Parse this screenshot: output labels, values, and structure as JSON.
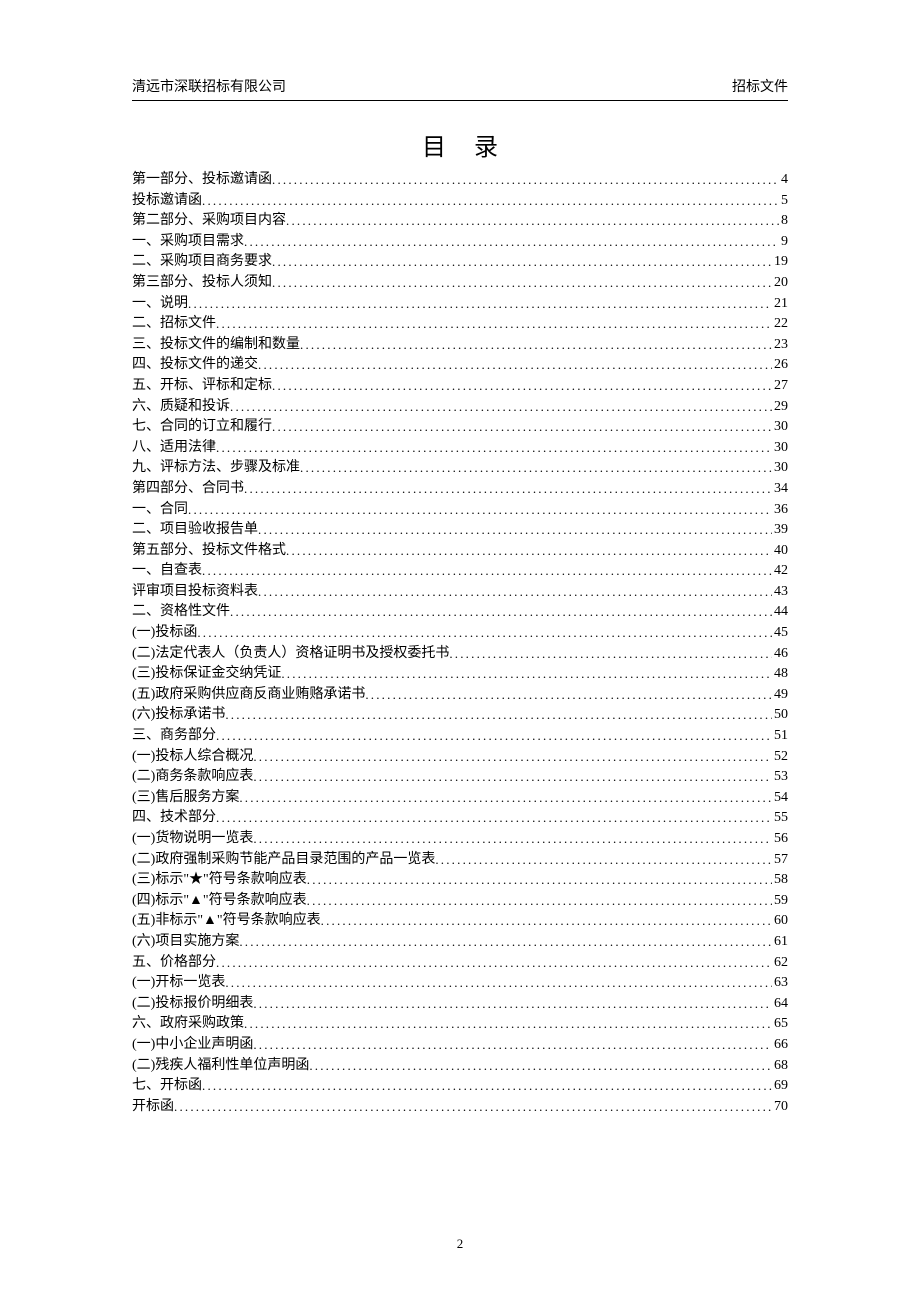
{
  "header": {
    "left": "清远市深联招标有限公司",
    "right": "招标文件"
  },
  "title": "目录",
  "toc": [
    {
      "label": "第一部分、投标邀请函",
      "page": "4"
    },
    {
      "label": "投标邀请函",
      "page": "5"
    },
    {
      "label": "第二部分、采购项目内容",
      "page": "8"
    },
    {
      "label": "一、采购项目需求",
      "page": "9"
    },
    {
      "label": "二、采购项目商务要求",
      "page": "19"
    },
    {
      "label": "第三部分、投标人须知",
      "page": "20"
    },
    {
      "label": "一、说明",
      "page": "21"
    },
    {
      "label": "二、招标文件",
      "page": "22"
    },
    {
      "label": "三、投标文件的编制和数量",
      "page": "23"
    },
    {
      "label": "四、投标文件的递交",
      "page": "26"
    },
    {
      "label": "五、开标、评标和定标",
      "page": "27"
    },
    {
      "label": "六、质疑和投诉",
      "page": "29"
    },
    {
      "label": "七、合同的订立和履行",
      "page": "30"
    },
    {
      "label": "八、适用法律",
      "page": "30"
    },
    {
      "label": "九、评标方法、步骤及标准",
      "page": "30"
    },
    {
      "label": "第四部分、合同书",
      "page": "34"
    },
    {
      "label": "一、合同",
      "page": "36"
    },
    {
      "label": "二、项目验收报告单",
      "page": "39"
    },
    {
      "label": "第五部分、投标文件格式",
      "page": "40"
    },
    {
      "label": "一、自查表",
      "page": "42"
    },
    {
      "label": "评审项目投标资料表",
      "page": "43"
    },
    {
      "label": "二、资格性文件",
      "page": "44"
    },
    {
      "label": "(一)投标函",
      "page": "45"
    },
    {
      "label": "(二)法定代表人（负责人）资格证明书及授权委托书",
      "page": "46"
    },
    {
      "label": "(三)投标保证金交纳凭证",
      "page": "48"
    },
    {
      "label": "(五)政府采购供应商反商业贿赂承诺书",
      "page": "49"
    },
    {
      "label": "(六)投标承诺书",
      "page": "50"
    },
    {
      "label": "三、商务部分",
      "page": "51"
    },
    {
      "label": "(一)投标人综合概况",
      "page": "52"
    },
    {
      "label": "(二)商务条款响应表",
      "page": "53"
    },
    {
      "label": "(三)售后服务方案",
      "page": "54"
    },
    {
      "label": "四、技术部分",
      "page": "55"
    },
    {
      "label": "(一)货物说明一览表",
      "page": "56"
    },
    {
      "label": "(二)政府强制采购节能产品目录范围的产品一览表",
      "page": "57"
    },
    {
      "label": "(三)标示\"★\"符号条款响应表",
      "page": "58"
    },
    {
      "label": "(四)标示\"▲\"符号条款响应表",
      "page": "59"
    },
    {
      "label": "(五)非标示\"▲\"符号条款响应表",
      "page": "60"
    },
    {
      "label": "(六)项目实施方案",
      "page": "61"
    },
    {
      "label": "五、价格部分",
      "page": "62"
    },
    {
      "label": "(一)开标一览表",
      "page": "63"
    },
    {
      "label": "(二)投标报价明细表",
      "page": "64"
    },
    {
      "label": "六、政府采购政策",
      "page": "65"
    },
    {
      "label": "(一)中小企业声明函",
      "page": "66"
    },
    {
      "label": "(二)残疾人福利性单位声明函",
      "page": "68"
    },
    {
      "label": "七、开标函",
      "page": "69"
    },
    {
      "label": "开标函",
      "page": "70"
    }
  ],
  "footer": {
    "page_number": "2"
  }
}
